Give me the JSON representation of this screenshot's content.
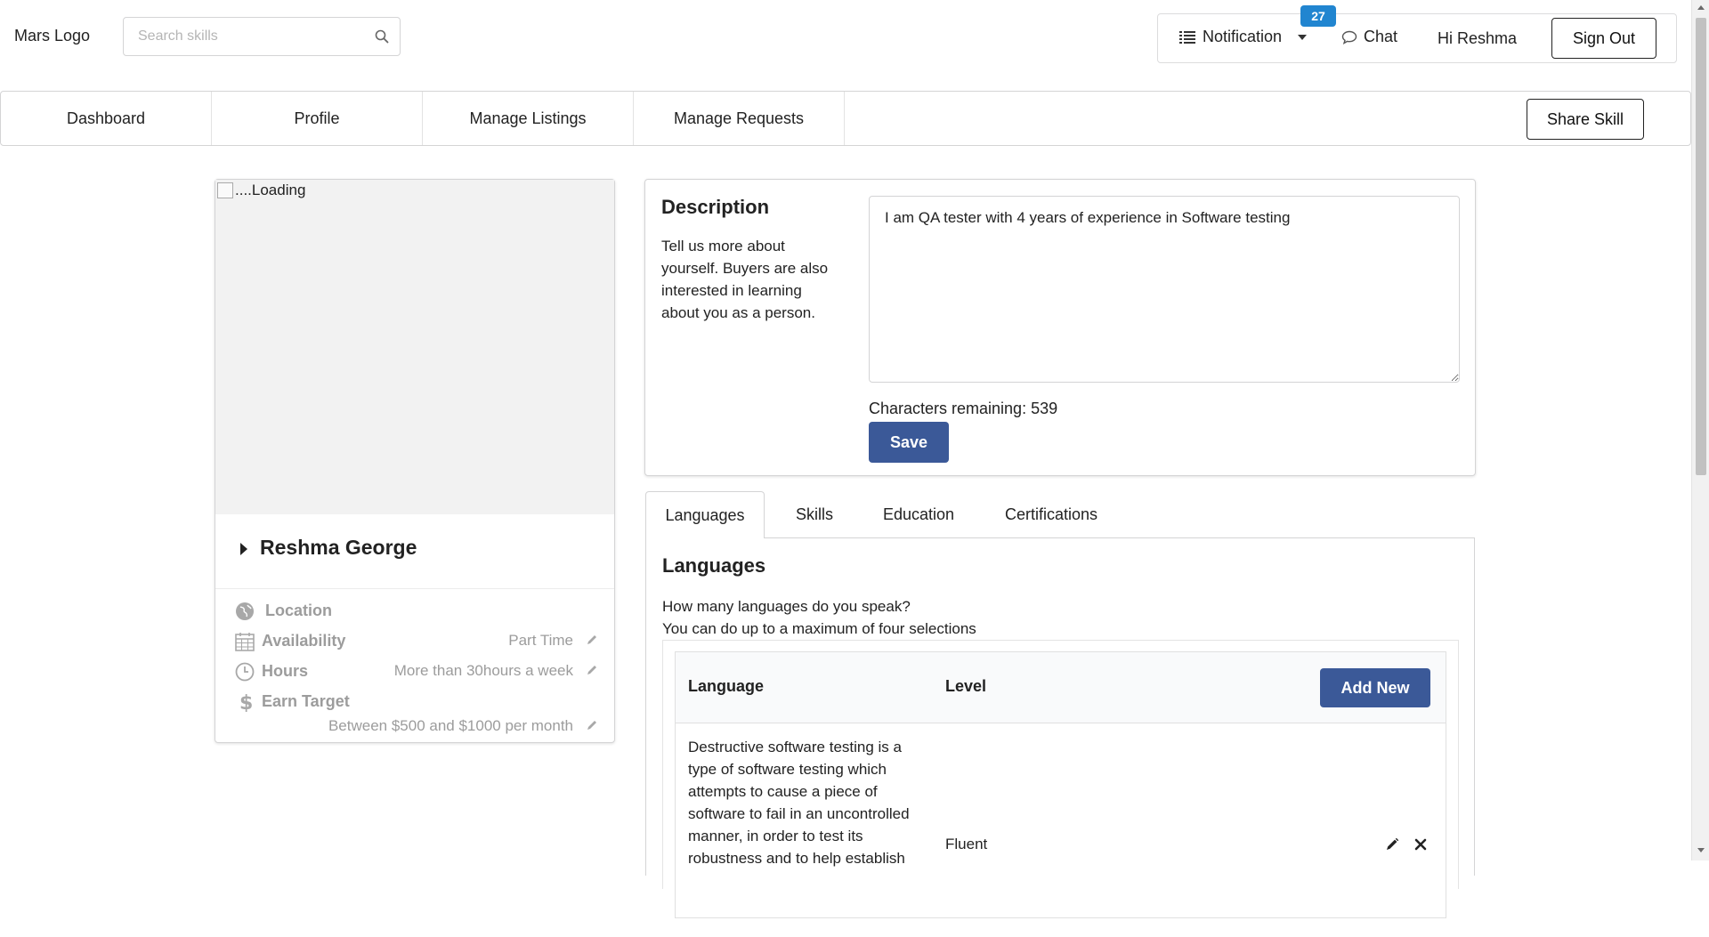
{
  "header": {
    "logo": "Mars Logo",
    "search_placeholder": "Search skills",
    "notification_label": "Notification",
    "notification_count": "27",
    "chat_label": "Chat",
    "greeting": "Hi Reshma",
    "sign_out_label": "Sign Out"
  },
  "nav": {
    "items": [
      "Dashboard",
      "Profile",
      "Manage Listings",
      "Manage Requests"
    ],
    "share_skill_label": "Share Skill"
  },
  "profile": {
    "image_alt": "....Loading",
    "name": "Reshma George",
    "location_label": "Location",
    "availability_label": "Availability",
    "availability_value": "Part Time",
    "hours_label": "Hours",
    "hours_value": "More than 30hours a week",
    "earn_target_label": "Earn Target",
    "earn_target_value": "Between $500 and $1000 per month"
  },
  "description": {
    "title": "Description",
    "help_text": "Tell us more about yourself. Buyers are also interested in learning about you as a person.",
    "value": "I am QA tester with 4 years of experience in Software testing",
    "chars_remaining": "Characters remaining: 539",
    "save_label": "Save"
  },
  "tabs": {
    "items": [
      "Languages",
      "Skills",
      "Education",
      "Certifications"
    ],
    "active": "Languages"
  },
  "languages": {
    "title": "Languages",
    "subtitle_line1": "How many languages do you speak?",
    "subtitle_line2": "You can do up to a maximum of four selections",
    "col_language": "Language",
    "col_level": "Level",
    "add_new_label": "Add New",
    "rows": [
      {
        "language": "Destructive software testing is a type of software testing which attempts to cause a piece of software to fail in an uncontrolled manner, in order to test its robustness and to help establish",
        "level": "Fluent"
      }
    ]
  },
  "colors": {
    "primary_button": "#3b5998",
    "badge": "#2185d0",
    "muted_text": "#9c9c9c"
  }
}
